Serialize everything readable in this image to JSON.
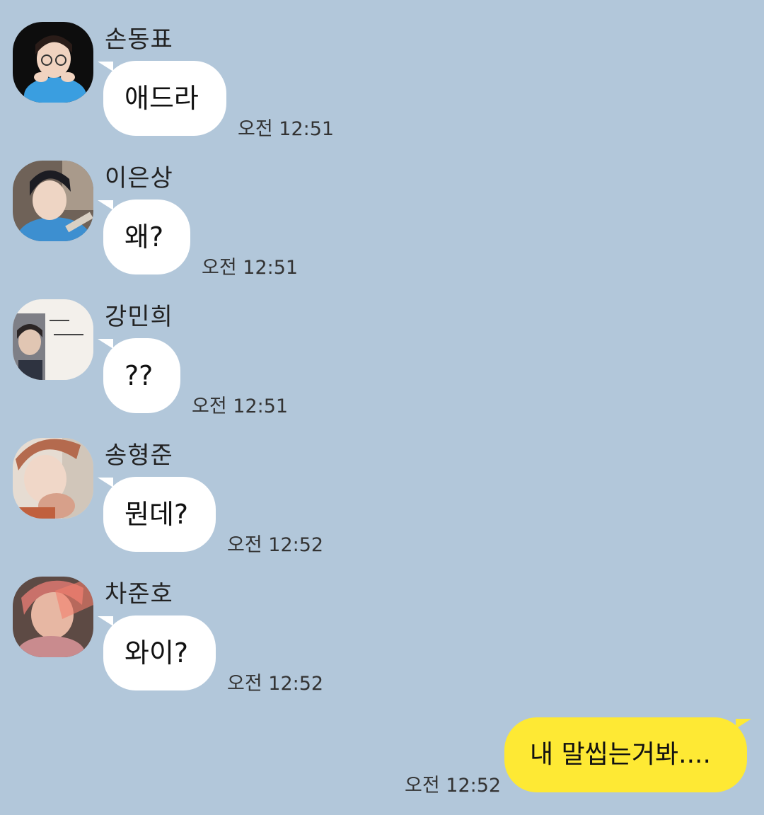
{
  "messages": [
    {
      "sender": "손동표",
      "text": "애드라",
      "time": "오전 12:51",
      "avatar": "photo-glasses-blue-shirt"
    },
    {
      "sender": "이은상",
      "text": "왜?",
      "time": "오전 12:51",
      "avatar": "photo-car-selfie"
    },
    {
      "sender": "강민희",
      "text": "??",
      "time": "오전 12:51",
      "avatar": "photo-nametag"
    },
    {
      "sender": "송형준",
      "text": "뭔데?",
      "time": "오전 12:52",
      "avatar": "photo-hand-on-chin"
    },
    {
      "sender": "차준호",
      "text": "와이?",
      "time": "오전 12:52",
      "avatar": "photo-pink-light"
    }
  ],
  "my_message": {
    "text": "내 말씹는거봐....",
    "time": "오전 12:52"
  },
  "colors": {
    "background": "#b2c7da",
    "incoming_bubble": "#ffffff",
    "outgoing_bubble": "#fee934"
  }
}
